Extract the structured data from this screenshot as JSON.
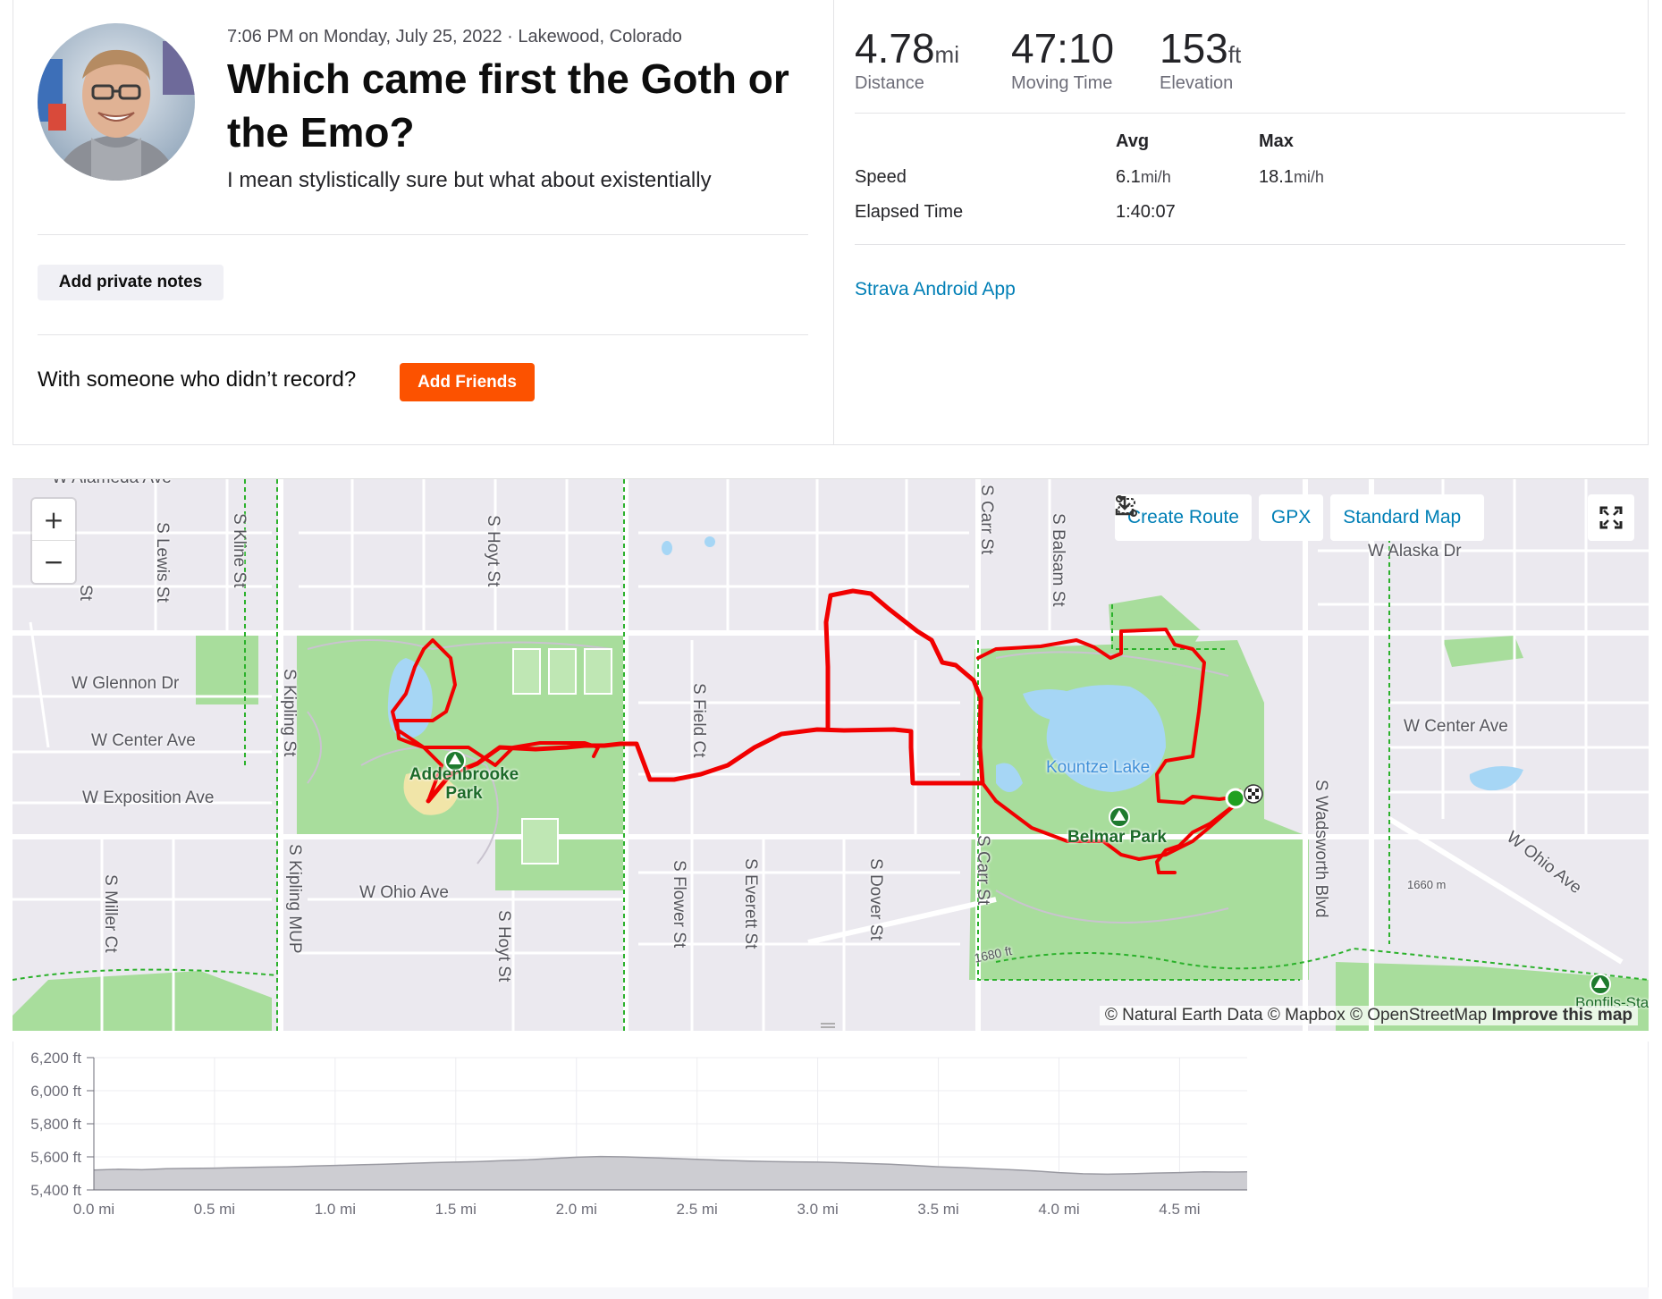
{
  "header": {
    "meta": "7:06 PM on Monday, July 25, 2022 · Lakewood, Colorado",
    "title": "Which came first the Goth or the Emo?",
    "description": "I mean stylistically sure but what about existentially",
    "private_notes_label": "Add private notes",
    "with_someone": "With someone who didn’t record?",
    "add_friends_label": "Add Friends"
  },
  "stats": {
    "distance": {
      "value": "4.78",
      "unit": "mi",
      "label": "Distance"
    },
    "moving_time": {
      "value": "47:10",
      "label": "Moving Time"
    },
    "elevation": {
      "value": "153",
      "unit": "ft",
      "label": "Elevation"
    }
  },
  "table": {
    "col_avg": "Avg",
    "col_max": "Max",
    "speed_label": "Speed",
    "speed_avg": "6.1",
    "speed_max": "18.1",
    "speed_unit": "mi/h",
    "elapsed_label": "Elapsed Time",
    "elapsed_value": "1:40:07"
  },
  "device": "Strava Android App",
  "map": {
    "zoom_in": "+",
    "zoom_out": "−",
    "create_route": "Create Route",
    "gpx": "GPX",
    "map_type": "Standard Map",
    "attribution_prefix": "© Natural Earth Data © Mapbox © OpenStreetMap",
    "attribution_link": "Improve this map",
    "route_color": "#f10000",
    "park_color": "#a8dd9c",
    "water_color": "#a6d6f5",
    "labels": {
      "w_alameda": "W Alameda Ave",
      "s_lewis": "S Lewis St",
      "s_kline": "S Kline St",
      "s_hoyt_top": "S Hoyt St",
      "s_hoyt_bottom": "S Hoyt St",
      "st_left": "St",
      "w_glennon": "W Glennon Dr",
      "w_center_left": "W Center Ave",
      "w_exposition": "W Exposition Ave",
      "s_kipling": "S Kipling St",
      "s_kipling_mup": "S Kipling MUP",
      "s_miller": "S Miller Ct",
      "w_ohio_left": "W Ohio Ave",
      "addenbrooke": "Addenbrooke Park",
      "s_field": "S Field Ct",
      "s_flower": "S Flower St",
      "s_everett": "S Everett St",
      "s_dover": "S Dover St",
      "s_carr_top": "S Carr St",
      "s_carr_bottom": "S Carr St",
      "s_balsam": "S Balsam St",
      "kountze": "Kountze Lake",
      "belmar": "Belmar Park",
      "s_wadsworth": "S Wadsworth Blvd",
      "w_alaska": "W Alaska Dr",
      "w_center_right": "W Center Ave",
      "w_ohio_right": "W Ohio Ave",
      "bonfils": "Bonfils-Stanton Pa",
      "contour": "1680 ft",
      "contour2": "1660 m"
    }
  },
  "elevation_chart": {
    "type": "area",
    "xlabel": "",
    "ylabel": "",
    "y_ticks": [
      "5,400 ft",
      "5,600 ft",
      "5,800 ft",
      "6,000 ft",
      "6,200 ft"
    ],
    "x_ticks": [
      "0.0 mi",
      "0.5 mi",
      "1.0 mi",
      "1.5 mi",
      "2.0 mi",
      "2.5 mi",
      "3.0 mi",
      "3.5 mi",
      "4.0 mi",
      "4.5 mi"
    ],
    "ylim": [
      5400,
      6200
    ],
    "xlim": [
      0,
      4.78
    ],
    "x": [
      0,
      0.1,
      0.2,
      0.3,
      0.4,
      0.5,
      0.6,
      0.7,
      0.8,
      0.9,
      1.0,
      1.1,
      1.2,
      1.3,
      1.4,
      1.5,
      1.6,
      1.7,
      1.8,
      1.9,
      2.0,
      2.1,
      2.2,
      2.3,
      2.4,
      2.5,
      2.6,
      2.7,
      2.8,
      2.9,
      3.0,
      3.1,
      3.2,
      3.3,
      3.4,
      3.5,
      3.6,
      3.7,
      3.8,
      3.9,
      4.0,
      4.1,
      4.2,
      4.3,
      4.4,
      4.5,
      4.6,
      4.7,
      4.78
    ],
    "values": [
      5520,
      5525,
      5522,
      5528,
      5530,
      5532,
      5535,
      5538,
      5540,
      5545,
      5548,
      5552,
      5555,
      5560,
      5565,
      5568,
      5572,
      5578,
      5582,
      5590,
      5598,
      5602,
      5600,
      5595,
      5590,
      5585,
      5580,
      5575,
      5572,
      5570,
      5568,
      5565,
      5560,
      5555,
      5548,
      5540,
      5535,
      5528,
      5522,
      5515,
      5505,
      5498,
      5495,
      5498,
      5502,
      5505,
      5510,
      5508,
      5510
    ],
    "fill_color": "#cdcdd2",
    "line_color": "#9a9aa2"
  }
}
